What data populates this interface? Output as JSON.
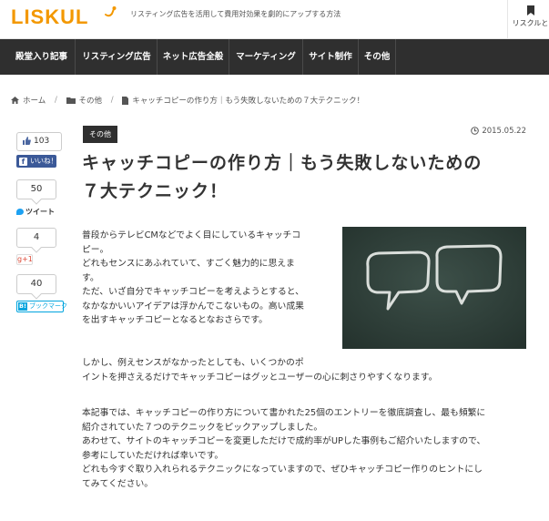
{
  "header": {
    "logo_text": "LISKUL",
    "tagline": "リスティング広告を活用して費用対効果を劇的にアップする方法",
    "right_label": "リスクルと",
    "colors": {
      "brand": "#f39800",
      "nav_bg": "#2f2f2f"
    }
  },
  "nav": {
    "items": [
      {
        "label": "殿堂入り記事"
      },
      {
        "label": "リスティング広告"
      },
      {
        "label": "ネット広告全般"
      },
      {
        "label": "マーケティング"
      },
      {
        "label": "サイト制作"
      },
      {
        "label": "その他"
      }
    ]
  },
  "breadcrumb": {
    "home": "ホーム",
    "category": "その他",
    "current": "キャッチコピーの作り方｜もう失敗しないための７大テクニック！"
  },
  "share": {
    "like_count": "103",
    "fb_label": "いいね！",
    "tweet_count": "50",
    "tweet_label": "ツイート",
    "gplus_count": "4",
    "gplus_label": "g+1",
    "hatena_count": "40",
    "hatena_label": "ブックマーク",
    "hatena_b": "B!"
  },
  "article": {
    "tag": "その他",
    "date": "2015.05.22",
    "title_line1": "キャッチコピーの作り方｜もう失敗しないための",
    "title_line2": "７大テクニック！",
    "p1": [
      "普段からテレビCMなどでよく目にしているキャッチコ",
      "ピー。",
      "どれもセンスにあふれていて、すごく魅力的に思えま",
      "す。",
      "ただ、いざ自分でキャッチコピーを考えようとすると、",
      "なかなかいいアイデアは浮かんでこないもの。高い成果",
      "を出すキャッチコピーとなるとなおさらです。"
    ],
    "p2": [
      "しかし、例えセンスがなかったとしても、いくつかのポ",
      "イントを押さえるだけでキャッチコピーはグッとユーザーの心に刺さりやすくなります。"
    ],
    "p3": [
      "本記事では、キャッチコピーの作り方について書かれた25個のエントリーを徹底調査し、最も頻繁に",
      "紹介されていた７つのテクニックをピックアップしました。",
      "あわせて、サイトのキャッチコピーを変更しただけで成約率がUPした事例もご紹介いたしますので、",
      "参考にしていただければ幸いです。",
      "どれも今すぐ取り入れられるテクニックになっていますので、ぜひキャッチコピー作りのヒントにし",
      "てみてください。"
    ]
  }
}
